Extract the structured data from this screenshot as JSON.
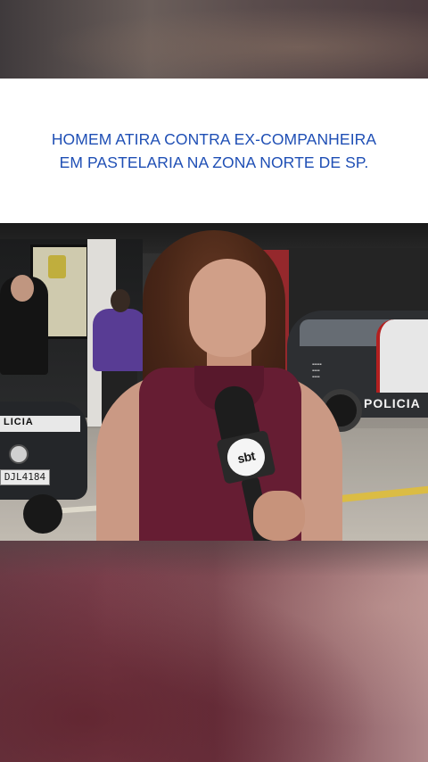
{
  "headline": {
    "line1": "HOMEM ATIRA CONTRA EX-COMPANHEIRA",
    "line2": "EM PASTELARIA NA ZONA NORTE DE SP."
  },
  "video": {
    "mic_logo": "sbt",
    "police_car_right_label": "POLICIA",
    "police_car_left_label": "LICIA",
    "plate": "DJL4184"
  },
  "colors": {
    "headline_text": "#1f4fb5",
    "headline_card_bg": "#ffffff",
    "backdrop": "#6a3a44"
  }
}
